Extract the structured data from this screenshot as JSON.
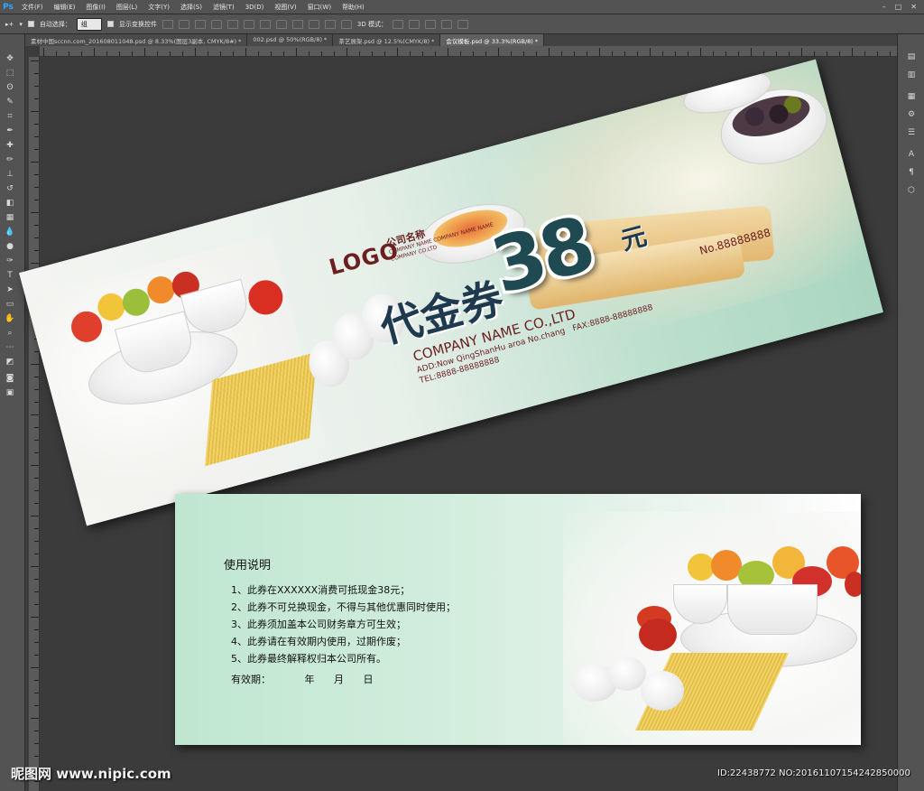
{
  "app": {
    "logo": "Ps"
  },
  "menu": [
    "文件(F)",
    "编辑(E)",
    "图像(I)",
    "图层(L)",
    "文字(Y)",
    "选择(S)",
    "滤镜(T)",
    "3D(D)",
    "视图(V)",
    "窗口(W)",
    "帮助(H)"
  ],
  "window_controls": [
    "–",
    "□",
    "✕"
  ],
  "options": {
    "auto_select_label": "自动选择：",
    "auto_select_value": "组",
    "show_transform_label": "显示变换控件",
    "mode_3d_label": "3D 模式："
  },
  "tabs": [
    {
      "label": "素材中国sccnn.com_201608011048.psd @ 8.33%(图层3副本, CMYK/8#) *",
      "active": false
    },
    {
      "label": "002.psd @ 50%(RGB/8) *",
      "active": false
    },
    {
      "label": "茶艺展架.psd @ 12.5%(CMYK/8) *",
      "active": false
    },
    {
      "label": "会议模板.psd @ 33.3%(RGB/8) *",
      "active": true
    }
  ],
  "voucher": {
    "logo": "LOGO",
    "company_cn": "公司名称",
    "company_en_small": "COMPANY NAME COMPANY NAME NAME COMPANY CO.LTD",
    "title": "代金券",
    "amount": "38",
    "unit": "元",
    "number": "No.88888888",
    "company_name": "COMPANY NAME CO.,LTD",
    "address": "ADD:Now QingShanHu aroa No.chang",
    "fax": "FAX:8888-88888888",
    "tel": "TEL:8888-88888888"
  },
  "back": {
    "title": "使用说明",
    "items": [
      "1、此券在XXXXXX消费可抵现金38元；",
      "2、此券不可兑换现金，不得与其他优惠同时使用；",
      "3、此券须加盖本公司财务章方可生效；",
      "4、此券请在有效期内使用，过期作废；",
      "5、此券最终解释权归本公司所有。"
    ],
    "validity_label": "有效期：",
    "year": "年",
    "month": "月",
    "day": "日"
  },
  "watermark": {
    "site": "昵图网 www.nipic.com",
    "id": "ID:22438772 NO:20161107154242850000"
  }
}
